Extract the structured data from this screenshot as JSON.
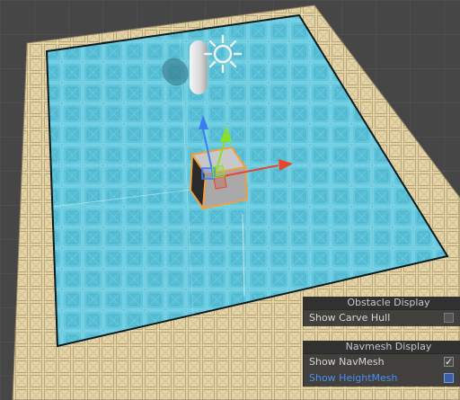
{
  "viewport": {
    "obstacle_panel": {
      "title": "Obstacle Display",
      "items": [
        {
          "label": "Show Carve Hull",
          "checked": false
        }
      ]
    },
    "navmesh_panel": {
      "title": "Navmesh Display",
      "items": [
        {
          "label": "Show NavMesh",
          "checked": true
        },
        {
          "label": "Show HeightMesh",
          "checked": false,
          "highlighted": true
        }
      ]
    }
  },
  "colors": {
    "background": "#464646",
    "navmesh_fill": "#4fc8e6",
    "floor_tile": "#e6d6a8",
    "gizmo_x": "#e8452f",
    "gizmo_y": "#8adf2a",
    "gizmo_z": "#3a7df0",
    "label_highlight": "#4a8ef0"
  },
  "icons": [
    "sun-light-icon",
    "capsule-object",
    "cube-object",
    "move-gizmo-icon",
    "checkmark-icon"
  ]
}
